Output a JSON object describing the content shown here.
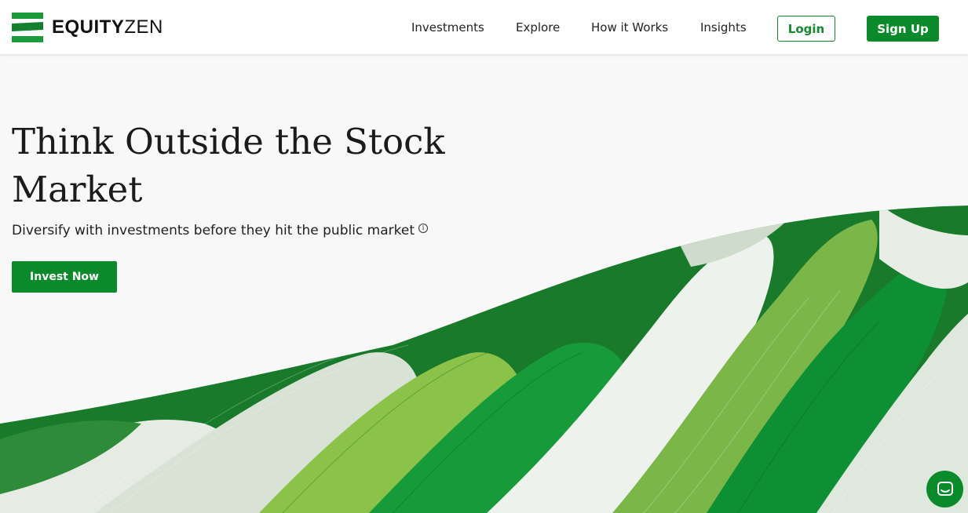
{
  "brand": {
    "name_bold": "EQUITY",
    "name_light": "ZEN",
    "logo_icon": "stacked-stripes-logo"
  },
  "nav": {
    "links": [
      "Investments",
      "Explore",
      "How it Works",
      "Insights"
    ],
    "login_label": "Login",
    "signup_label": "Sign Up"
  },
  "hero": {
    "title": "Think Outside the Stock Market",
    "subtitle": "Diversify with investments before they hit the public market",
    "info_glyph": "i",
    "cta_label": "Invest Now",
    "art": "green-and-white-ribbon-waves"
  },
  "chat": {
    "icon": "chat-bubble-icon"
  },
  "colors": {
    "brand_green": "#0a8a2a",
    "background": "#f8f8f8",
    "header_bg": "#ffffff"
  }
}
